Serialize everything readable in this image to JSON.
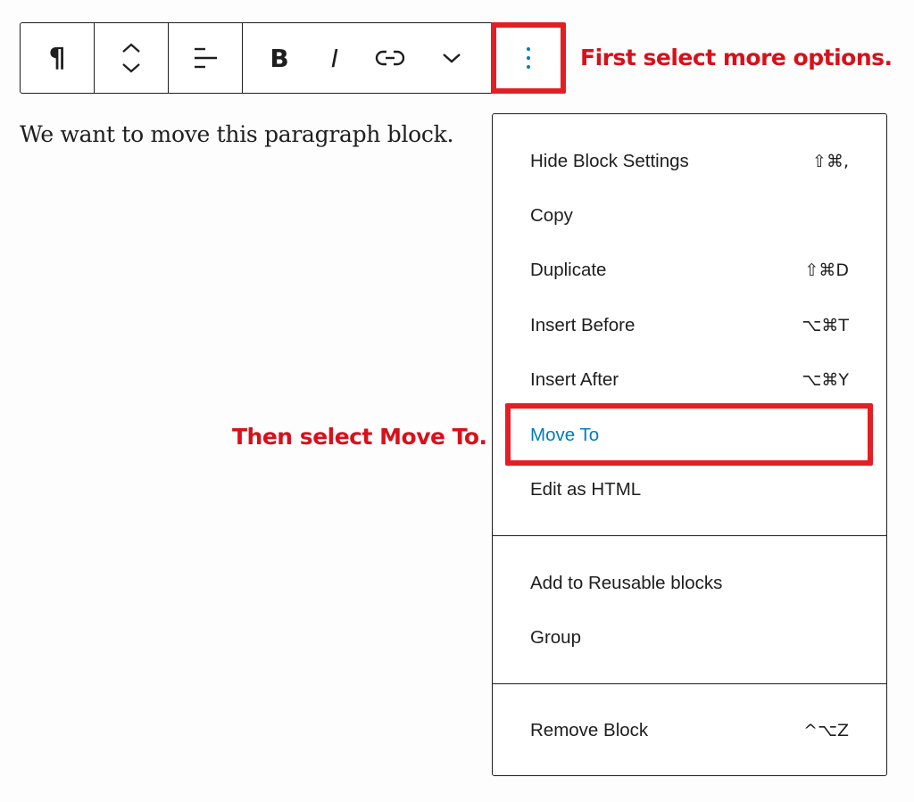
{
  "toolbar": {
    "buttons": [
      {
        "name": "paragraph",
        "icon": "pilcrow-icon",
        "glyph": "¶"
      },
      {
        "name": "move-up-down",
        "icon": "up-down-chevrons-icon"
      },
      {
        "name": "align",
        "icon": "align-left-icon"
      },
      {
        "name": "bold",
        "icon": "bold-icon",
        "glyph": "B"
      },
      {
        "name": "italic",
        "icon": "italic-icon",
        "glyph": "I"
      },
      {
        "name": "link",
        "icon": "link-icon"
      },
      {
        "name": "more-rich-text",
        "icon": "chevron-down-icon"
      },
      {
        "name": "more-options",
        "icon": "vertical-ellipsis-icon"
      }
    ],
    "accent_color": "#007cba"
  },
  "annotations": {
    "first": "First select more options.",
    "then": "Then select Move To.",
    "color": "#d7111a",
    "highlight_color": "#e31e24"
  },
  "editor": {
    "paragraph_text": "We want to move this paragraph block."
  },
  "menu": {
    "groups": [
      [
        {
          "label": "Hide Block Settings",
          "shortcut": "⇧⌘,"
        },
        {
          "label": "Copy",
          "shortcut": ""
        },
        {
          "label": "Duplicate",
          "shortcut": "⇧⌘D"
        },
        {
          "label": "Insert Before",
          "shortcut": "⌥⌘T"
        },
        {
          "label": "Insert After",
          "shortcut": "⌥⌘Y"
        },
        {
          "label": "Move To",
          "shortcut": "",
          "active": true
        },
        {
          "label": "Edit as HTML",
          "shortcut": ""
        }
      ],
      [
        {
          "label": "Add to Reusable blocks",
          "shortcut": ""
        },
        {
          "label": "Group",
          "shortcut": ""
        }
      ],
      [
        {
          "label": "Remove Block",
          "shortcut": "^⌥Z"
        }
      ]
    ]
  }
}
